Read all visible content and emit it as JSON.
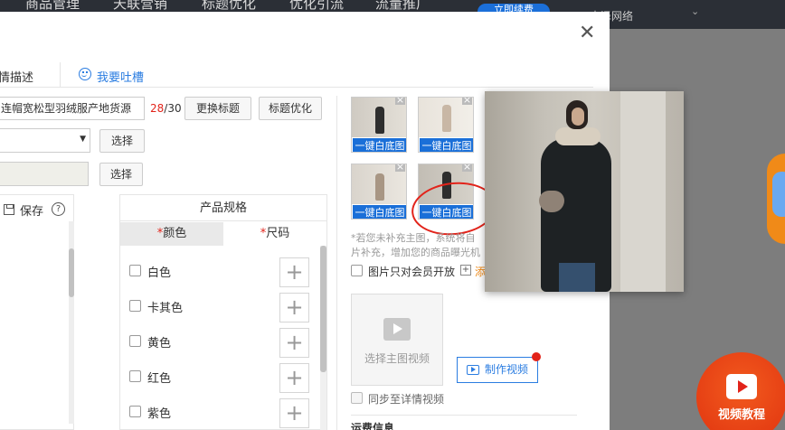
{
  "topnav": {
    "items": [
      "商品管理",
      "天联营销",
      "标题优化",
      "优化引流",
      "流量推广"
    ],
    "pill": "立即续费",
    "store": "大泽网络"
  },
  "tabs": {
    "description": "情描述",
    "feedback": "我要吐槽"
  },
  "title": {
    "value": "连帽宽松型羽绒服产地货源",
    "count_current": "28",
    "count_max": "/30",
    "replace_btn": "更换标题",
    "optimize_btn": "标题优化"
  },
  "select_btn_1": "选择",
  "select_btn_2": "选择",
  "toolbar": {
    "save": "保存",
    "help": "?"
  },
  "spec": {
    "title": "产品规格",
    "tab_color": "颜色",
    "tab_size": "尺码",
    "required": "*",
    "colors": [
      "白色",
      "卡其色",
      "黄色",
      "红色",
      "紫色"
    ]
  },
  "images": {
    "white_bg_label": "一键白底图",
    "tip_line1": "*若您未补充主图，系统将自",
    "tip_line2": "片补充，增加您的商品曝光机",
    "members_only": "图片只对会员开放",
    "members_more": "添"
  },
  "video": {
    "select_main": "选择主图视频",
    "make": "制作视频",
    "sync": "同步至详情视频"
  },
  "section": {
    "shipping": "运费信息"
  },
  "tutorial": {
    "label": "视频教程"
  }
}
